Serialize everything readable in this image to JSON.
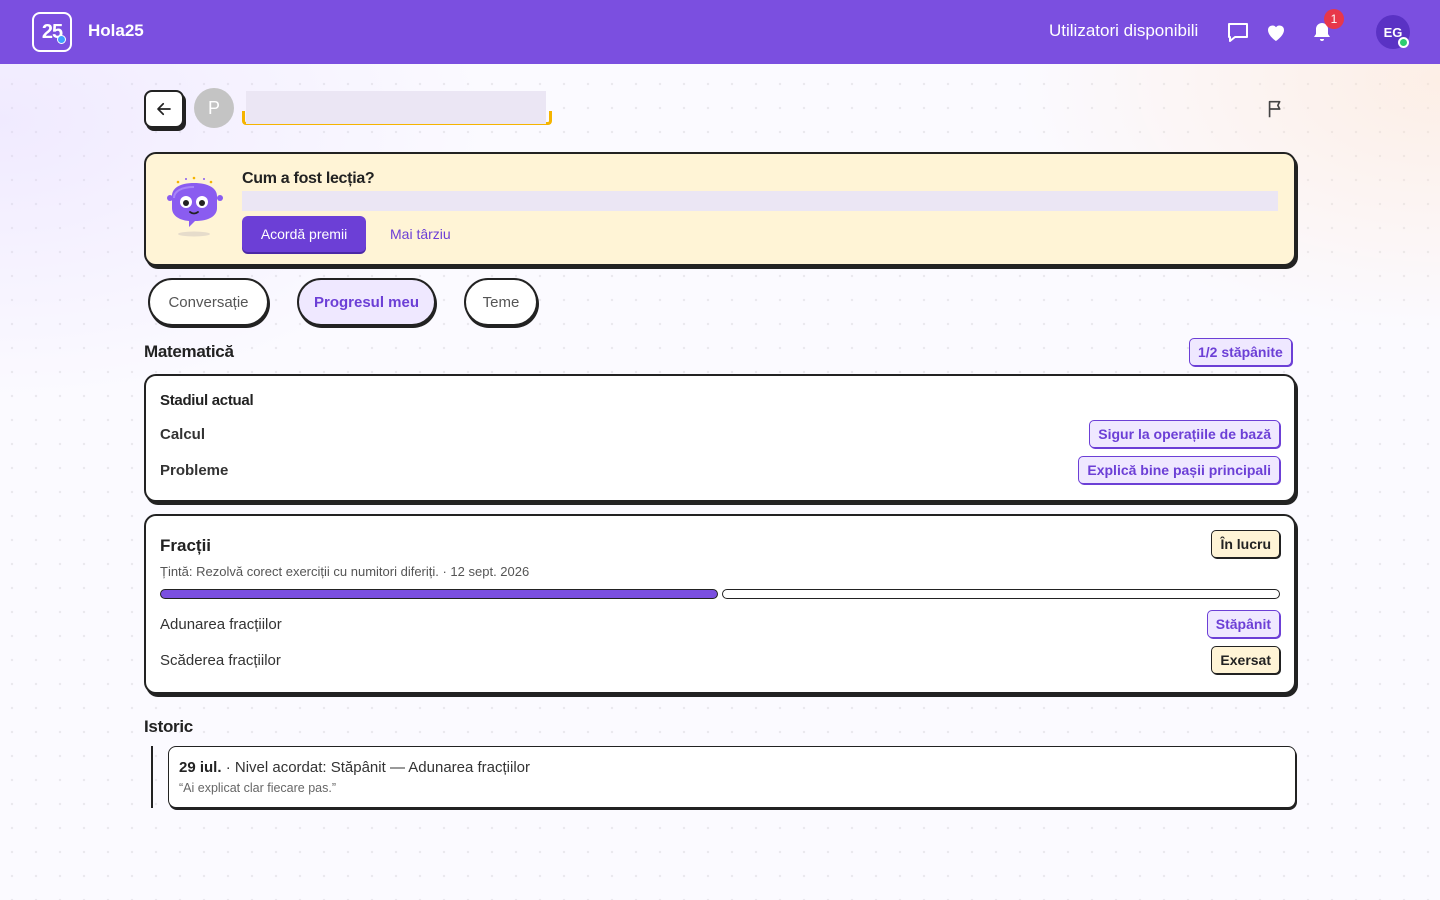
{
  "topbar": {
    "logo_text": "25",
    "brand": "Hola25",
    "users_available": "Utilizatori disponibili",
    "notification_count": "1",
    "user_initials": "EG",
    "background_color": "#7b4fe0",
    "icons": [
      "chat-icon",
      "heart-icon",
      "bell-icon"
    ]
  },
  "header": {
    "peer_initial": "P",
    "icons": [
      "arrow-left-icon",
      "flag-icon"
    ]
  },
  "feedback": {
    "title": "Cum a fost lecția?",
    "award_button": "Acordă premii",
    "later_link": "Mai târziu"
  },
  "tabs": [
    {
      "label": "Conversație",
      "active": false
    },
    {
      "label": "Progresul meu",
      "active": true
    },
    {
      "label": "Teme",
      "active": false
    }
  ],
  "subject": {
    "title": "Matematică",
    "mastered_badge": "1/2 stăpânite"
  },
  "current_stage": {
    "title": "Stadiul actual",
    "rows": [
      {
        "label": "Calcul",
        "badge": "Sigur la operațiile de bază"
      },
      {
        "label": "Probleme",
        "badge": "Explică bine pașii principali"
      }
    ]
  },
  "topic": {
    "title": "Fracții",
    "status": "În lucru",
    "goal": "Țintă: Rezolvă corect exerciții cu numitori diferiți. · 12 sept. 2026",
    "progress": {
      "completed": 1,
      "total": 2
    },
    "skills": [
      {
        "label": "Adunarea fracțiilor",
        "status": "Stăpânit",
        "style": "purple"
      },
      {
        "label": "Scăderea fracțiilor",
        "status": "Exersat",
        "style": "yellow"
      }
    ]
  },
  "history": {
    "title": "Istoric",
    "entries": [
      {
        "date": "29 iul.",
        "text": " · Nivel acordat: Stăpânit — Adunarea fracțiilor",
        "quote": "“Ai explicat clar fiecare pas.”"
      }
    ]
  },
  "colors": {
    "accent": "#7b4fe0",
    "button": "#6c3fd6",
    "feedback_bg": "#fff4d6",
    "notification": "#e8374a",
    "online": "#2ecc71"
  }
}
